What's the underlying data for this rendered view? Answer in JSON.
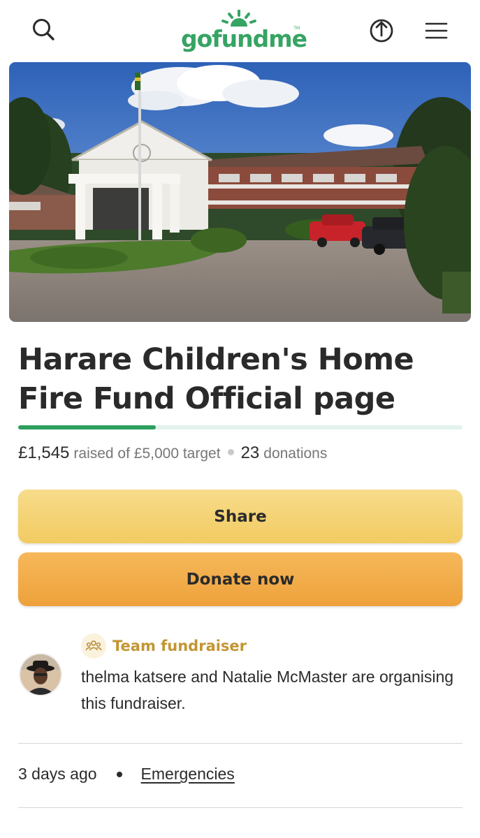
{
  "header": {
    "logo_text": "gofundme",
    "logo_tm": "TM"
  },
  "campaign": {
    "title": "Harare Children's Home Fire Fund Official page",
    "raised": "£1,545",
    "raised_suffix": "raised of £5,000 target",
    "donations_count": "23",
    "donations_label": "donations",
    "progress_fraction": 0.309
  },
  "actions": {
    "share_label": "Share",
    "donate_label": "Donate now"
  },
  "organiser": {
    "badge_label": "Team fundraiser",
    "text": "thelma katsere and Natalie McMaster are organising this fundraiser."
  },
  "meta": {
    "posted": "3 days ago",
    "category": "Emergencies"
  },
  "icons": [
    "search-icon",
    "upload-share-icon",
    "hamburger-menu-icon",
    "team-icon"
  ],
  "colors": {
    "brand_green": "#36a463",
    "progress": "#2d9f5e",
    "share_button": "#f4d274",
    "donate_button": "#f0a84a",
    "team_label": "#c39533"
  }
}
